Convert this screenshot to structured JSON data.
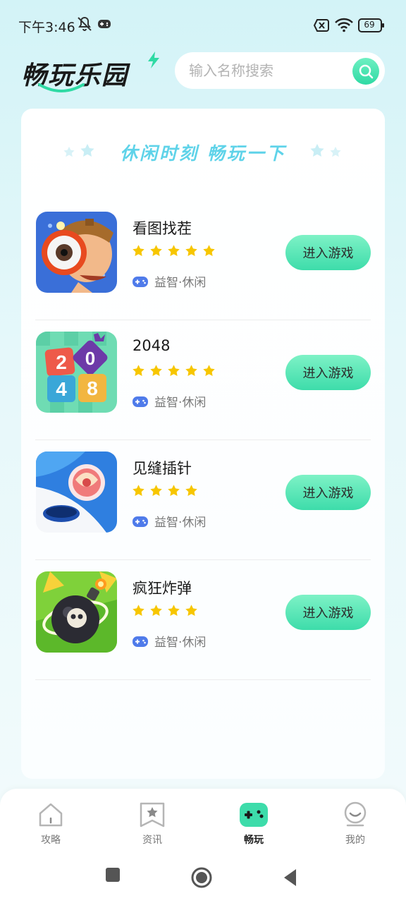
{
  "status_bar": {
    "time": "下午3:46",
    "battery": "69"
  },
  "header": {
    "logo_text": "畅玩乐园",
    "search_placeholder": "输入名称搜索"
  },
  "banner": {
    "title": "休闲时刻  畅玩一下"
  },
  "games": [
    {
      "name": "看图找茬",
      "stars": 5,
      "tag": "益智·休闲",
      "button": "进入游戏"
    },
    {
      "name": "2048",
      "stars": 5,
      "tag": "益智·休闲",
      "button": "进入游戏"
    },
    {
      "name": "见缝插针",
      "stars": 4,
      "tag": "益智·休闲",
      "button": "进入游戏"
    },
    {
      "name": "疯狂炸弹",
      "stars": 4,
      "tag": "益智·休闲",
      "button": "进入游戏"
    }
  ],
  "bottom_nav": [
    {
      "label": "攻略",
      "icon": "house-icon",
      "active": false
    },
    {
      "label": "资讯",
      "icon": "bookmark-star-icon",
      "active": false
    },
    {
      "label": "畅玩",
      "icon": "gamepad-icon",
      "active": true
    },
    {
      "label": "我的",
      "icon": "profile-icon",
      "active": false
    }
  ],
  "colors": {
    "accent": "#3ddcaa",
    "star": "#f7c600",
    "banner_text": "#5fd3e9"
  }
}
